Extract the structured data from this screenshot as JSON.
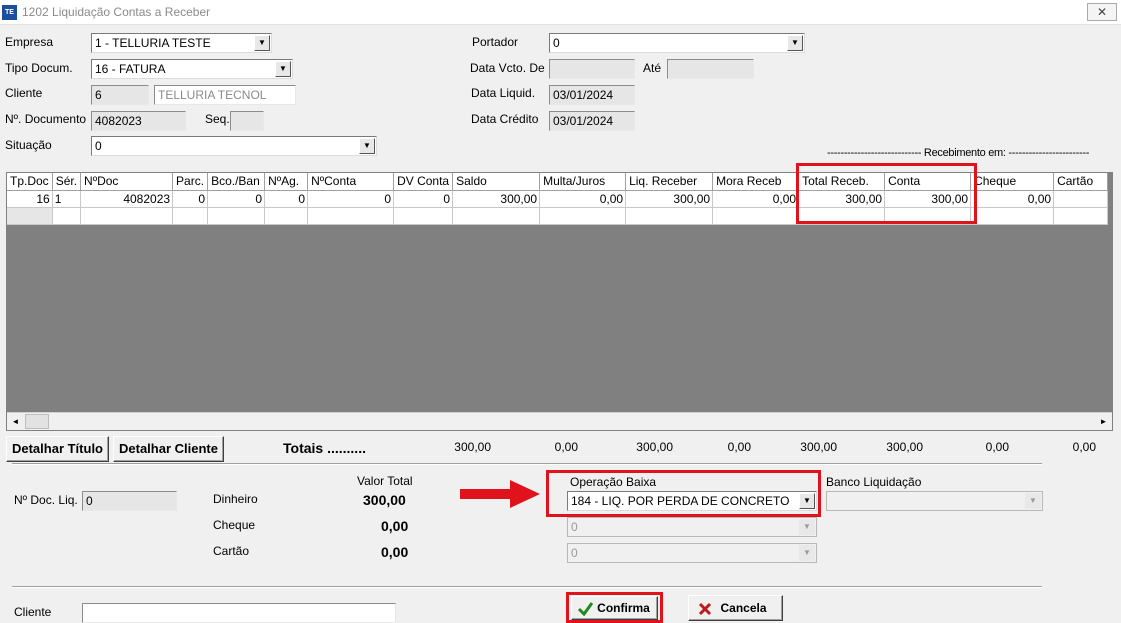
{
  "window": {
    "title": "1202 Liquidação Contas a Receber",
    "icon_label": "TE",
    "close_glyph": "✕"
  },
  "form": {
    "empresa": {
      "label": "Empresa",
      "value": "1 - TELLURIA TESTE"
    },
    "tipo_docum": {
      "label": "Tipo Docum.",
      "value": "16 - FATURA"
    },
    "cliente": {
      "label": "Cliente",
      "code": "6",
      "name": "TELLURIA TECNOL"
    },
    "num_documento": {
      "label": "Nº. Documento",
      "value": "4082023"
    },
    "seq": {
      "label": "Seq.",
      "value": ""
    },
    "situacao": {
      "label": "Situação",
      "value": "0"
    },
    "portador": {
      "label": "Portador",
      "value": "0"
    },
    "data_vcto": {
      "label": "Data Vcto. De",
      "value": "",
      "ate_label": "Até",
      "ate_value": ""
    },
    "data_liquid": {
      "label": "Data Liquid.",
      "value": "03/01/2024"
    },
    "data_credito": {
      "label": "Data Crédito",
      "value": "03/01/2024"
    }
  },
  "recebimento_caption": "---------------------------- Recebimento em: ------------------------",
  "grid": {
    "columns": [
      "Tp.Doc",
      "Sér.",
      "NºDoc",
      "Parc.",
      "Bco./Ban",
      "NºAg.",
      "NºConta",
      "DV Conta",
      "Saldo",
      "Multa/Juros",
      "Liq. Receber",
      "Mora Receb",
      "Total Receb.",
      "Conta",
      "Cheque",
      "Cartão"
    ],
    "rows": [
      [
        "16",
        "1",
        "4082023",
        "0",
        "0",
        "0",
        "0",
        "0",
        "300,00",
        "0,00",
        "300,00",
        "0,00",
        "300,00",
        "300,00",
        "0,00",
        ""
      ]
    ]
  },
  "buttons": {
    "detalhar_titulo": "Detalhar Título",
    "detalhar_cliente": "Detalhar Cliente",
    "confirma": "Confirma",
    "cancela": "Cancela"
  },
  "totais": {
    "label": "Totais ..........",
    "values": [
      "300,00",
      "0,00",
      "300,00",
      "0,00",
      "300,00",
      "300,00",
      "0,00",
      "0,00"
    ]
  },
  "liquidacao": {
    "num_doc_liq": {
      "label": "Nº Doc. Liq.",
      "value": "0"
    },
    "valor_total_label": "Valor Total",
    "dinheiro": {
      "label": "Dinheiro",
      "value": "300,00"
    },
    "cheque": {
      "label": "Cheque",
      "value": "0,00",
      "combo": "0"
    },
    "cartao": {
      "label": "Cartão",
      "value": "0,00",
      "combo": "0"
    },
    "operacao_baixa": {
      "label": "Operação Baixa",
      "value": "184 - LIQ. POR PERDA DE CONCRETO"
    },
    "banco_liquidacao": {
      "label": "Banco Liquidação",
      "value": ""
    },
    "cliente": {
      "label": "Cliente",
      "value": ""
    }
  },
  "colors": {
    "highlight": "#e0121b",
    "grid_background": "#808080",
    "confirm_check": "#1f8a1f",
    "cancel_x": "#c0181c"
  },
  "icons": {
    "confirm": "check-icon",
    "cancel": "x-icon",
    "annotation": "red-arrow-icon"
  }
}
